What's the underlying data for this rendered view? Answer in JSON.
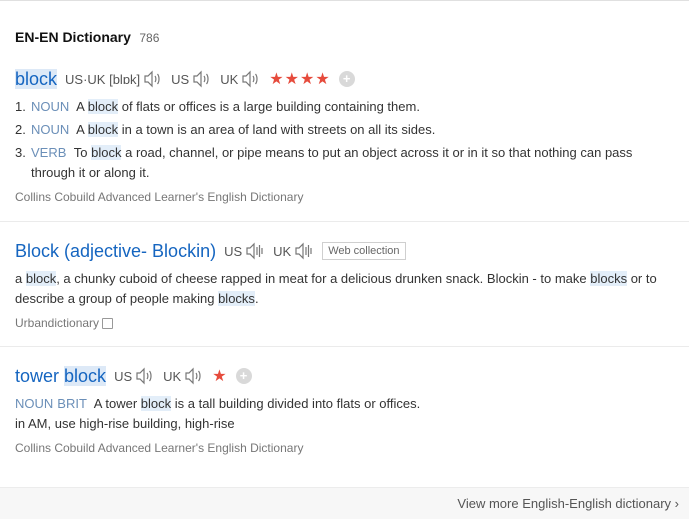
{
  "header": {
    "title": "EN-EN Dictionary",
    "count": "786"
  },
  "entries": [
    {
      "headword_pre": "",
      "headword_hl": "block",
      "headword_post": "",
      "pron1": "US·UK [blɒk]",
      "pron2": "US",
      "pron3": "UK",
      "stars": "★★★★",
      "defs": [
        {
          "num": "1.",
          "pos": "NOUN",
          "pre": " A ",
          "hl": "block",
          "post": " of flats or offices is a large building containing them."
        },
        {
          "num": "2.",
          "pos": "NOUN",
          "pre": " A ",
          "hl": "block",
          "post": " in a town is an area of land with streets on all its sides."
        },
        {
          "num": "3.",
          "pos": "VERB",
          "pre": " To ",
          "hl": "block",
          "post": " a road, channel, or pipe means to put an object across it or in it so that nothing can pass through it or along it."
        }
      ],
      "source": "Collins Cobuild Advanced Learner's English Dictionary"
    },
    {
      "headword": "Block (adjective- Blockin)",
      "pron1": "US",
      "pron2": "UK",
      "tag": "Web collection",
      "text": {
        "p1": "a ",
        "h1": "block",
        "p2": ", a chunky cuboid of cheese rapped in meat for a delicious drunken snack. Blockin - to make ",
        "h2": "blocks",
        "p3": " or to describe a group of people making ",
        "h3": "blocks",
        "p4": "."
      },
      "source": "Urbandictionary"
    },
    {
      "headword_pre": "tower ",
      "headword_hl": "block",
      "pron1": "US",
      "pron2": "UK",
      "stars": "★",
      "def": {
        "pos1": "NOUN",
        "pos2": "BRIT",
        "pre": " A tower ",
        "hl": "block",
        "post": " is a tall building divided into flats or offices."
      },
      "note": "in AM, use high-rise building, high-rise",
      "source": "Collins Cobuild Advanced Learner's English Dictionary"
    }
  ],
  "footer": {
    "more": "View more English-English dictionary ›"
  },
  "colors": {
    "link": "#1565c0",
    "star": "#e64b3c",
    "highlight": "#e3eef9",
    "pos": "#6b8fb8"
  }
}
